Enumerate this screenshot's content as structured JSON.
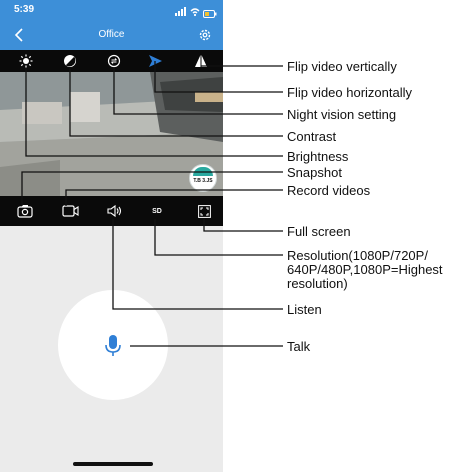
{
  "status_bar": {
    "time": "5:39"
  },
  "nav": {
    "title": "Office",
    "back_icon": "chevron-left-icon",
    "settings_icon": "gear-icon"
  },
  "video": {
    "badge": "T.B 3.JS"
  },
  "annotations": {
    "flip_vertical": "Flip video vertically",
    "flip_horizontal": "Flip video horizontally",
    "night_vision": "Night vision setting",
    "contrast": "Contrast",
    "brightness": "Brightness",
    "snapshot": "Snapshot",
    "record": "Record videos",
    "fullscreen": "Full screen",
    "resolution_line1": "Resolution(1080P/720P/",
    "resolution_line2": "640P/480P,1080P=Highest",
    "resolution_line3": "resolution)",
    "listen": "Listen",
    "talk": "Talk"
  },
  "bottom_bar": {
    "resolution_label": "SD"
  },
  "colors": {
    "header": "#3d8fd8",
    "toolbar": "#0a0a0a",
    "accent": "#2f7fd6",
    "background": "#ebebeb"
  }
}
